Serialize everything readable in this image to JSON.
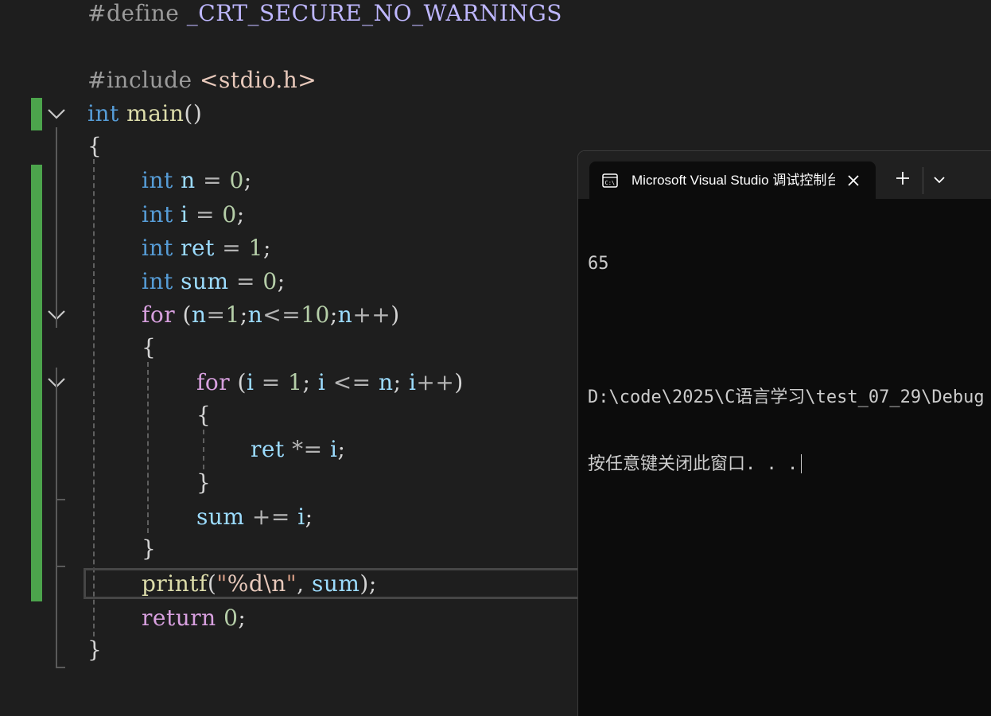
{
  "editor": {
    "lines": [
      {
        "tokens": [
          {
            "t": "#define ",
            "c": "pp"
          },
          {
            "t": "_CRT_SECURE_NO_WARNINGS",
            "c": "mac"
          }
        ]
      },
      {
        "tokens": []
      },
      {
        "tokens": [
          {
            "t": "#include ",
            "c": "pp"
          },
          {
            "t": "<stdio.h>",
            "c": "inc"
          }
        ]
      },
      {
        "tokens": [
          {
            "t": "int",
            "c": "kw"
          },
          {
            "t": " "
          },
          {
            "t": "main",
            "c": "fn"
          },
          {
            "t": "()"
          }
        ]
      },
      {
        "tokens": [
          {
            "t": "{"
          }
        ]
      },
      {
        "tokens": [
          {
            "t": "int",
            "c": "kw"
          },
          {
            "t": " "
          },
          {
            "t": "n",
            "c": "var"
          },
          {
            "t": " = ",
            "c": "op"
          },
          {
            "t": "0",
            "c": "num"
          },
          {
            "t": ";"
          }
        ]
      },
      {
        "tokens": [
          {
            "t": "int",
            "c": "kw"
          },
          {
            "t": " "
          },
          {
            "t": "i",
            "c": "var"
          },
          {
            "t": " = ",
            "c": "op"
          },
          {
            "t": "0",
            "c": "num"
          },
          {
            "t": ";"
          }
        ]
      },
      {
        "tokens": [
          {
            "t": "int",
            "c": "kw"
          },
          {
            "t": " "
          },
          {
            "t": "ret",
            "c": "var"
          },
          {
            "t": " = ",
            "c": "op"
          },
          {
            "t": "1",
            "c": "num"
          },
          {
            "t": ";"
          }
        ]
      },
      {
        "tokens": [
          {
            "t": "int",
            "c": "kw"
          },
          {
            "t": " "
          },
          {
            "t": "sum",
            "c": "var"
          },
          {
            "t": " = ",
            "c": "op"
          },
          {
            "t": "0",
            "c": "num"
          },
          {
            "t": ";"
          }
        ]
      },
      {
        "tokens": [
          {
            "t": "for",
            "c": "ctl"
          },
          {
            "t": " ("
          },
          {
            "t": "n",
            "c": "var"
          },
          {
            "t": "=",
            "c": "op"
          },
          {
            "t": "1",
            "c": "num"
          },
          {
            "t": ";"
          },
          {
            "t": "n",
            "c": "var"
          },
          {
            "t": "<=",
            "c": "op"
          },
          {
            "t": "10",
            "c": "num"
          },
          {
            "t": ";"
          },
          {
            "t": "n",
            "c": "var"
          },
          {
            "t": "++",
            "c": "op"
          },
          {
            "t": ")"
          }
        ]
      },
      {
        "tokens": [
          {
            "t": "{"
          }
        ]
      },
      {
        "tokens": [
          {
            "t": "for",
            "c": "ctl"
          },
          {
            "t": " ("
          },
          {
            "t": "i",
            "c": "var"
          },
          {
            "t": " = ",
            "c": "op"
          },
          {
            "t": "1",
            "c": "num"
          },
          {
            "t": "; "
          },
          {
            "t": "i",
            "c": "var"
          },
          {
            "t": " <= ",
            "c": "op"
          },
          {
            "t": "n",
            "c": "var"
          },
          {
            "t": "; "
          },
          {
            "t": "i",
            "c": "var"
          },
          {
            "t": "++",
            "c": "op"
          },
          {
            "t": ")"
          }
        ]
      },
      {
        "tokens": [
          {
            "t": "{"
          }
        ]
      },
      {
        "tokens": [
          {
            "t": "ret",
            "c": "var"
          },
          {
            "t": " *= ",
            "c": "op"
          },
          {
            "t": "i",
            "c": "var"
          },
          {
            "t": ";"
          }
        ]
      },
      {
        "tokens": [
          {
            "t": "}"
          }
        ]
      },
      {
        "tokens": [
          {
            "t": "sum",
            "c": "var"
          },
          {
            "t": " += ",
            "c": "op"
          },
          {
            "t": "i",
            "c": "var"
          },
          {
            "t": ";"
          }
        ]
      },
      {
        "tokens": [
          {
            "t": "}"
          }
        ]
      },
      {
        "tokens": [
          {
            "t": "printf",
            "c": "fn"
          },
          {
            "t": "("
          },
          {
            "t": "\"",
            "c": "str"
          },
          {
            "t": "%d",
            "c": "esc"
          },
          {
            "t": "\\n",
            "c": "esc"
          },
          {
            "t": "\"",
            "c": "str"
          },
          {
            "t": ", "
          },
          {
            "t": "sum",
            "c": "var"
          },
          {
            "t": ");"
          }
        ]
      },
      {
        "tokens": [
          {
            "t": "return",
            "c": "ctl"
          },
          {
            "t": " "
          },
          {
            "t": "0",
            "c": "num"
          },
          {
            "t": ";"
          }
        ]
      },
      {
        "tokens": [
          {
            "t": "}"
          }
        ]
      }
    ]
  },
  "console": {
    "tab_title": "Microsoft Visual Studio 调试控制台",
    "tab_icon": "terminal-icon",
    "close_icon": "close-icon",
    "new_tab_icon": "plus-icon",
    "dropdown_icon": "chevron-down-icon",
    "output": {
      "line1": "65",
      "line2": "",
      "line3": "D:\\code\\2025\\C语言学习\\test_07_29\\Debug",
      "line4": "按任意键关闭此窗口. . ."
    }
  },
  "colors": {
    "editor_bg": "#1e1e1e",
    "change_bar": "#4ca44c",
    "console_bg": "#0c0c0c",
    "titlebar_bg": "#202020"
  }
}
